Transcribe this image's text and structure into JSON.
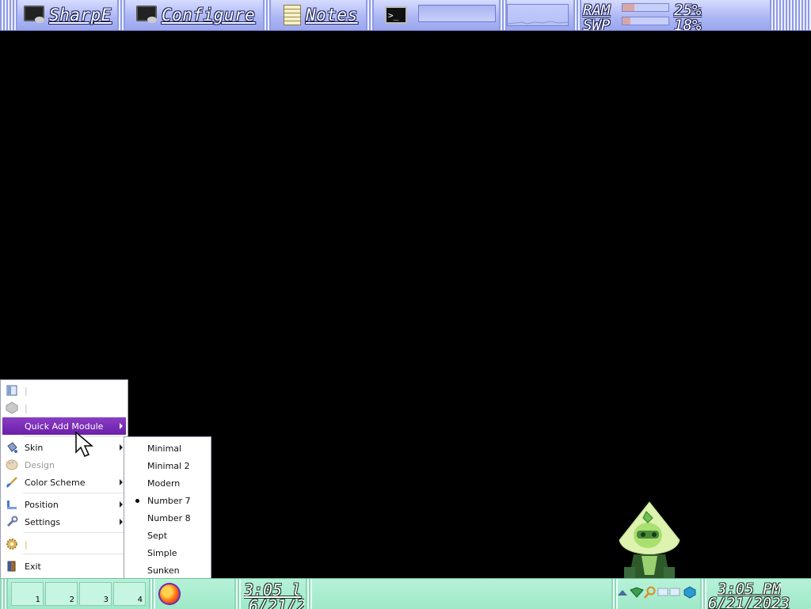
{
  "topbar": {
    "buttons": [
      {
        "label": "SharpE",
        "icon": "monitor-icon"
      },
      {
        "label": "Configure",
        "icon": "monitor-icon"
      },
      {
        "label": "Notes",
        "icon": "notes-icon"
      }
    ],
    "terminal_icon_text": ">_",
    "memory": {
      "ram_label": "RAM",
      "swp_label": "SWP",
      "ram_percent": "25%",
      "swp_percent": "18%",
      "ram_value": 0.25,
      "swp_value": 0.18
    }
  },
  "context_menu": {
    "items": [
      {
        "label": "|",
        "icon": "window-icon",
        "disabled": true
      },
      {
        "label": "|",
        "icon": "cube-icon",
        "disabled": true
      },
      {
        "label": "Quick Add Module",
        "highlighted": true,
        "submenu": true
      },
      {
        "label": "Skin",
        "icon": "paint-bucket-icon",
        "submenu": true
      },
      {
        "label": "Design",
        "icon": "palette-icon",
        "disabled": true
      },
      {
        "label": "Color Scheme",
        "icon": "brush-icon",
        "submenu": true
      },
      {
        "label": "Position",
        "icon": "position-icon",
        "submenu": true
      },
      {
        "label": "Settings",
        "icon": "wrench-icon",
        "submenu": true
      },
      {
        "label": "|",
        "icon": "gear-icon",
        "disabled": true
      },
      {
        "label": "Exit",
        "icon": "exit-door-icon"
      }
    ]
  },
  "skin_submenu": {
    "items": [
      "Minimal",
      "Minimal 2",
      "Modern",
      "Number 7",
      "Number 8",
      "Sept",
      "Simple",
      "Sunken"
    ],
    "selected": "Number 7"
  },
  "bottombar": {
    "desktops": [
      "1",
      "2",
      "3",
      "4"
    ],
    "clock_left_time": "3:05 l",
    "clock_left_date": "6/21/2",
    "clock_right_time": "3:05 PM",
    "clock_right_date": "6/21/2023"
  },
  "colors": {
    "topbar": "#aeb8f4",
    "bottombar": "#9fe8c8",
    "menu_highlight": "#6b1ea8",
    "desktop": "#000000"
  }
}
